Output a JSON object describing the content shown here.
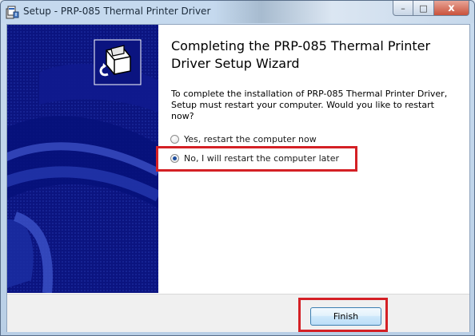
{
  "window": {
    "title": "Setup - PRP-085 Thermal Printer Driver",
    "close_glyph": "x",
    "minimize_glyph": "–",
    "maximize_glyph": "□"
  },
  "wizard": {
    "heading": "Completing the PRP-085 Thermal Printer\nDriver Setup Wizard",
    "description": "To complete the installation of PRP-085 Thermal Printer Driver,\nSetup must restart your computer. Would you like to restart\nnow?",
    "options": [
      {
        "label": "Yes, restart the computer now",
        "checked": false
      },
      {
        "label": "No, I will restart the computer later",
        "checked": true
      }
    ]
  },
  "footer": {
    "finish_label": "Finish"
  },
  "icons": {
    "title_icon": "setup-installer-icon",
    "banner_icon": "printer-install-icon"
  },
  "colors": {
    "banner": "#0b1480",
    "highlight": "#d42025",
    "button_border": "#3c7fb1"
  }
}
